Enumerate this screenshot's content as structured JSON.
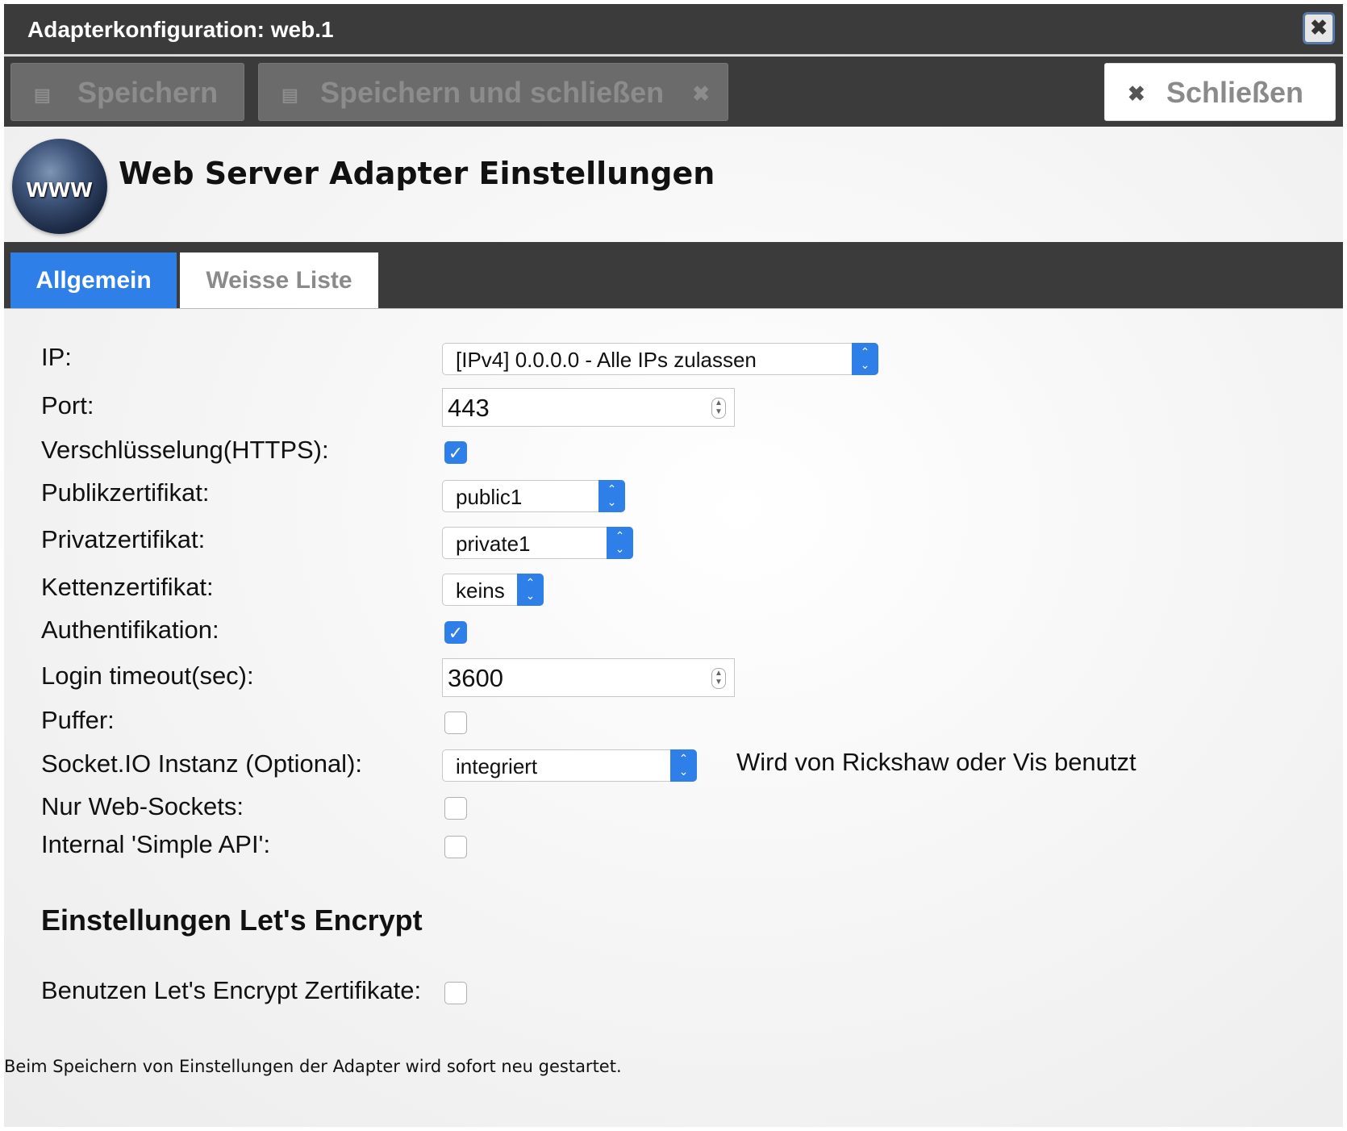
{
  "dialog": {
    "title": "Adapterkonfiguration: web.1",
    "close_glyph": "✖"
  },
  "toolbar": {
    "save_label": "Speichern",
    "save_close_label": "Speichern und schließen",
    "close_label": "Schließen"
  },
  "header": {
    "logo_text": "www",
    "title": "Web Server Adapter Einstellungen"
  },
  "tabs": [
    {
      "label": "Allgemein",
      "active": true
    },
    {
      "label": "Weisse Liste",
      "active": false
    }
  ],
  "form": {
    "ip": {
      "label": "IP:",
      "value": "[IPv4] 0.0.0.0 - Alle IPs zulassen"
    },
    "port": {
      "label": "Port:",
      "value": "443"
    },
    "https": {
      "label": "Verschlüsselung(HTTPS):",
      "checked": true
    },
    "public_cert": {
      "label": "Publikzertifikat:",
      "value": "public1"
    },
    "private_cert": {
      "label": "Privatzertifikat:",
      "value": "private1"
    },
    "chain_cert": {
      "label": "Kettenzertifikat:",
      "value": "keins"
    },
    "auth": {
      "label": "Authentifikation:",
      "checked": true
    },
    "login_timeout": {
      "label": "Login timeout(sec):",
      "value": "3600"
    },
    "buffer": {
      "label": "Puffer:",
      "checked": false
    },
    "socketio": {
      "label": "Socket.IO Instanz (Optional):",
      "value": "integriert",
      "hint": "Wird von Rickshaw oder Vis benutzt"
    },
    "websockets_only": {
      "label": "Nur Web-Sockets:",
      "checked": false
    },
    "simple_api": {
      "label": "Internal 'Simple API':",
      "checked": false
    }
  },
  "letsencrypt": {
    "section_title": "Einstellungen Let's Encrypt",
    "use_label": "Benutzen Let's Encrypt Zertifikate:",
    "use_checked": false
  },
  "footer_note": "Beim Speichern von Einstellungen der Adapter wird sofort neu gestartet.",
  "colors": {
    "accent": "#2f7fe8",
    "bar": "#3b3b3b"
  }
}
